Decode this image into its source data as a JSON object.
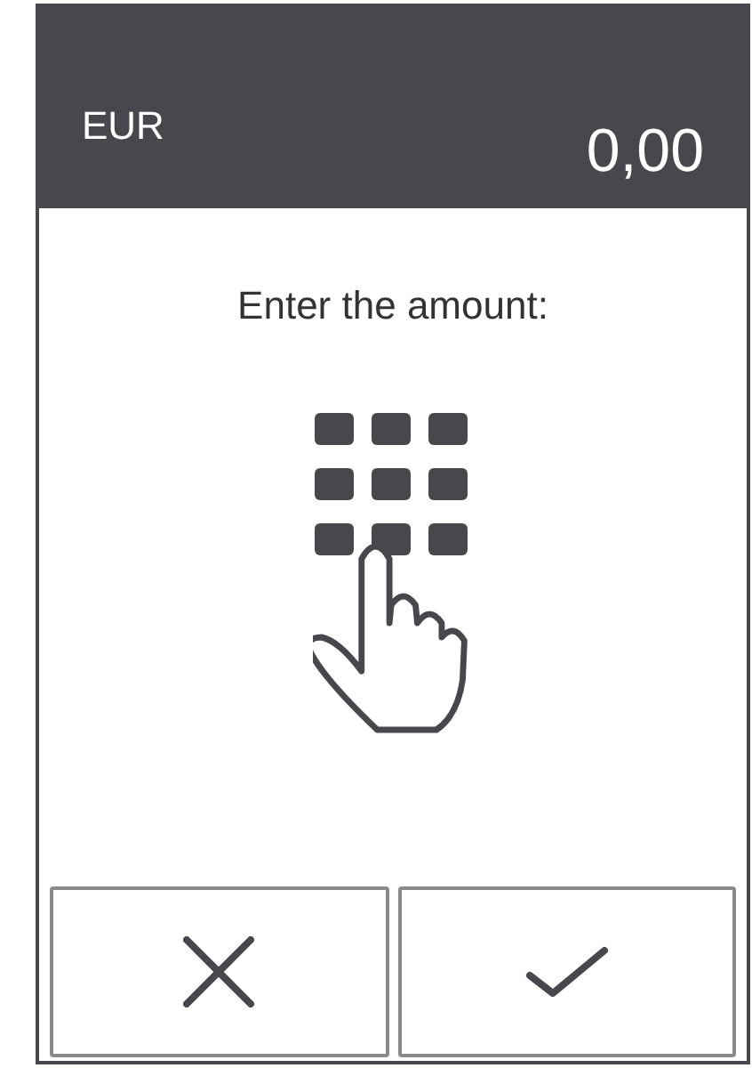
{
  "header": {
    "currency": "EUR",
    "amount": "0,00"
  },
  "prompt": "Enter the amount:",
  "buttons": [
    {
      "kind": "cancel"
    },
    {
      "kind": "confirm"
    }
  ]
}
